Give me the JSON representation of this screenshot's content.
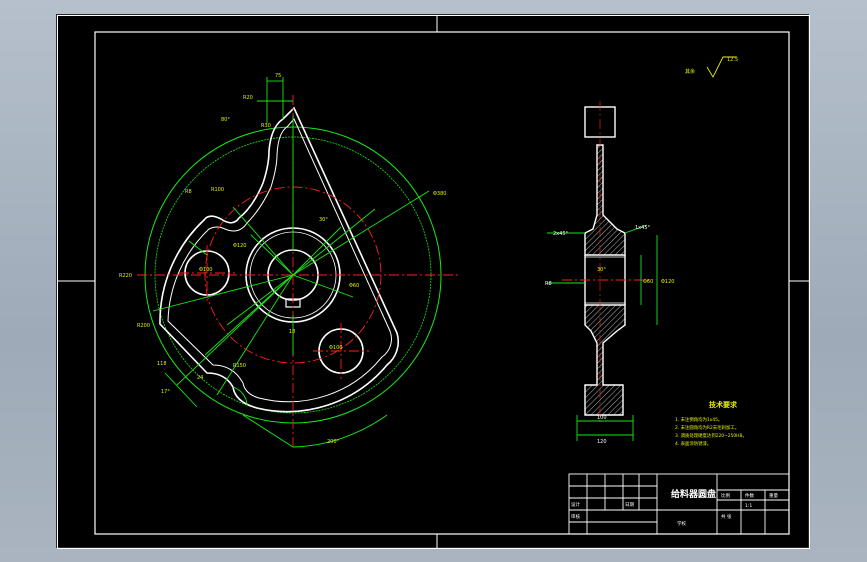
{
  "drawing": {
    "title": "给料器圆盘",
    "tech_requirements": {
      "heading": "技术要求",
      "items": [
        "1. 未注倒角均为1x45。",
        "2. 未注圆角均为R2去毛刺加工。",
        "3. 调质处理硬度达到220~250HB。",
        "4. 表面涂防锈漆。"
      ]
    },
    "roughness_note": "其余",
    "roughness_value": "12.5",
    "title_block": {
      "scale_label": "比例",
      "scale_value": "1:1",
      "qty_label": "件数",
      "weight_label": "重量",
      "sheet_label": "共 张",
      "designer_label": "设计",
      "checker_label": "审核",
      "date_label": "日期",
      "school_label": "学校"
    },
    "dimensions": {
      "top_width": "75",
      "d_outer": "Φ380",
      "d_bore": "Φ60",
      "d_hole": "Φ100",
      "d_hub": "Φ120",
      "angle_30": "30°",
      "angle_17": "17°",
      "angle_200": "200°",
      "angle_80": "80°",
      "r20": "R20",
      "r30": "R30",
      "r100": "R100",
      "r200": "R200",
      "r8": "R8",
      "hub_length": "120",
      "hub_inner": "100",
      "bore_right": "Φ60",
      "chamfer_top": "2x45°",
      "chamfer_side": "1x45°",
      "keyway": "18",
      "r150": "R150",
      "r220": "R220",
      "h118": "118",
      "len_24": "24"
    }
  },
  "colors": {
    "outline": "#ffffff",
    "dimension": "#18e818",
    "center": "#ff2020",
    "annotation": "#e6f000",
    "hatch": "#ffffff"
  }
}
